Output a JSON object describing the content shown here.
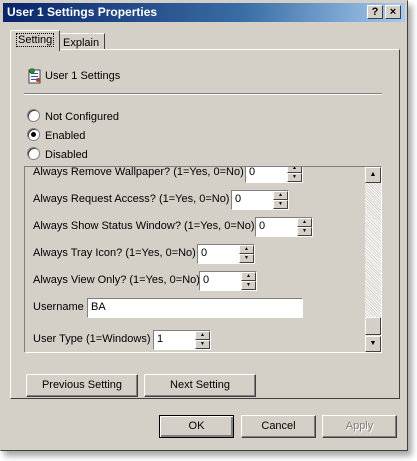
{
  "window": {
    "title": "User 1 Settings Properties",
    "help_button": "?",
    "close_button": "×"
  },
  "tabs": [
    {
      "label": "Setting",
      "active": true
    },
    {
      "label": "Explain",
      "active": false
    }
  ],
  "policy": {
    "title": "User 1 Settings",
    "icon": "policy-setting-icon"
  },
  "radios": [
    {
      "label": "Not Configured",
      "checked": false
    },
    {
      "label": "Enabled",
      "checked": true
    },
    {
      "label": "Disabled",
      "checked": false
    }
  ],
  "settings": [
    {
      "label": "Always Remove Wallpaper? (1=Yes, 0=No)",
      "value": "0"
    },
    {
      "label": "Always Request Access? (1=Yes, 0=No)",
      "value": "0"
    },
    {
      "label": "Always Show Status Window? (1=Yes, 0=No)",
      "value": "0"
    },
    {
      "label": "Always Tray Icon? (1=Yes, 0=No)",
      "value": "0"
    },
    {
      "label": "Always View Only? (1=Yes, 0=No)",
      "value": "0"
    },
    {
      "label": "Username",
      "value": "BA"
    },
    {
      "label": "User Type (1=Windows)",
      "value": "1"
    }
  ],
  "nav": {
    "previous": "Previous Setting",
    "next": "Next Setting"
  },
  "footer": {
    "ok": "OK",
    "cancel": "Cancel",
    "apply": "Apply"
  },
  "colors": {
    "title_gradient_start": "#0a246a",
    "face": "#d4d0c8"
  }
}
